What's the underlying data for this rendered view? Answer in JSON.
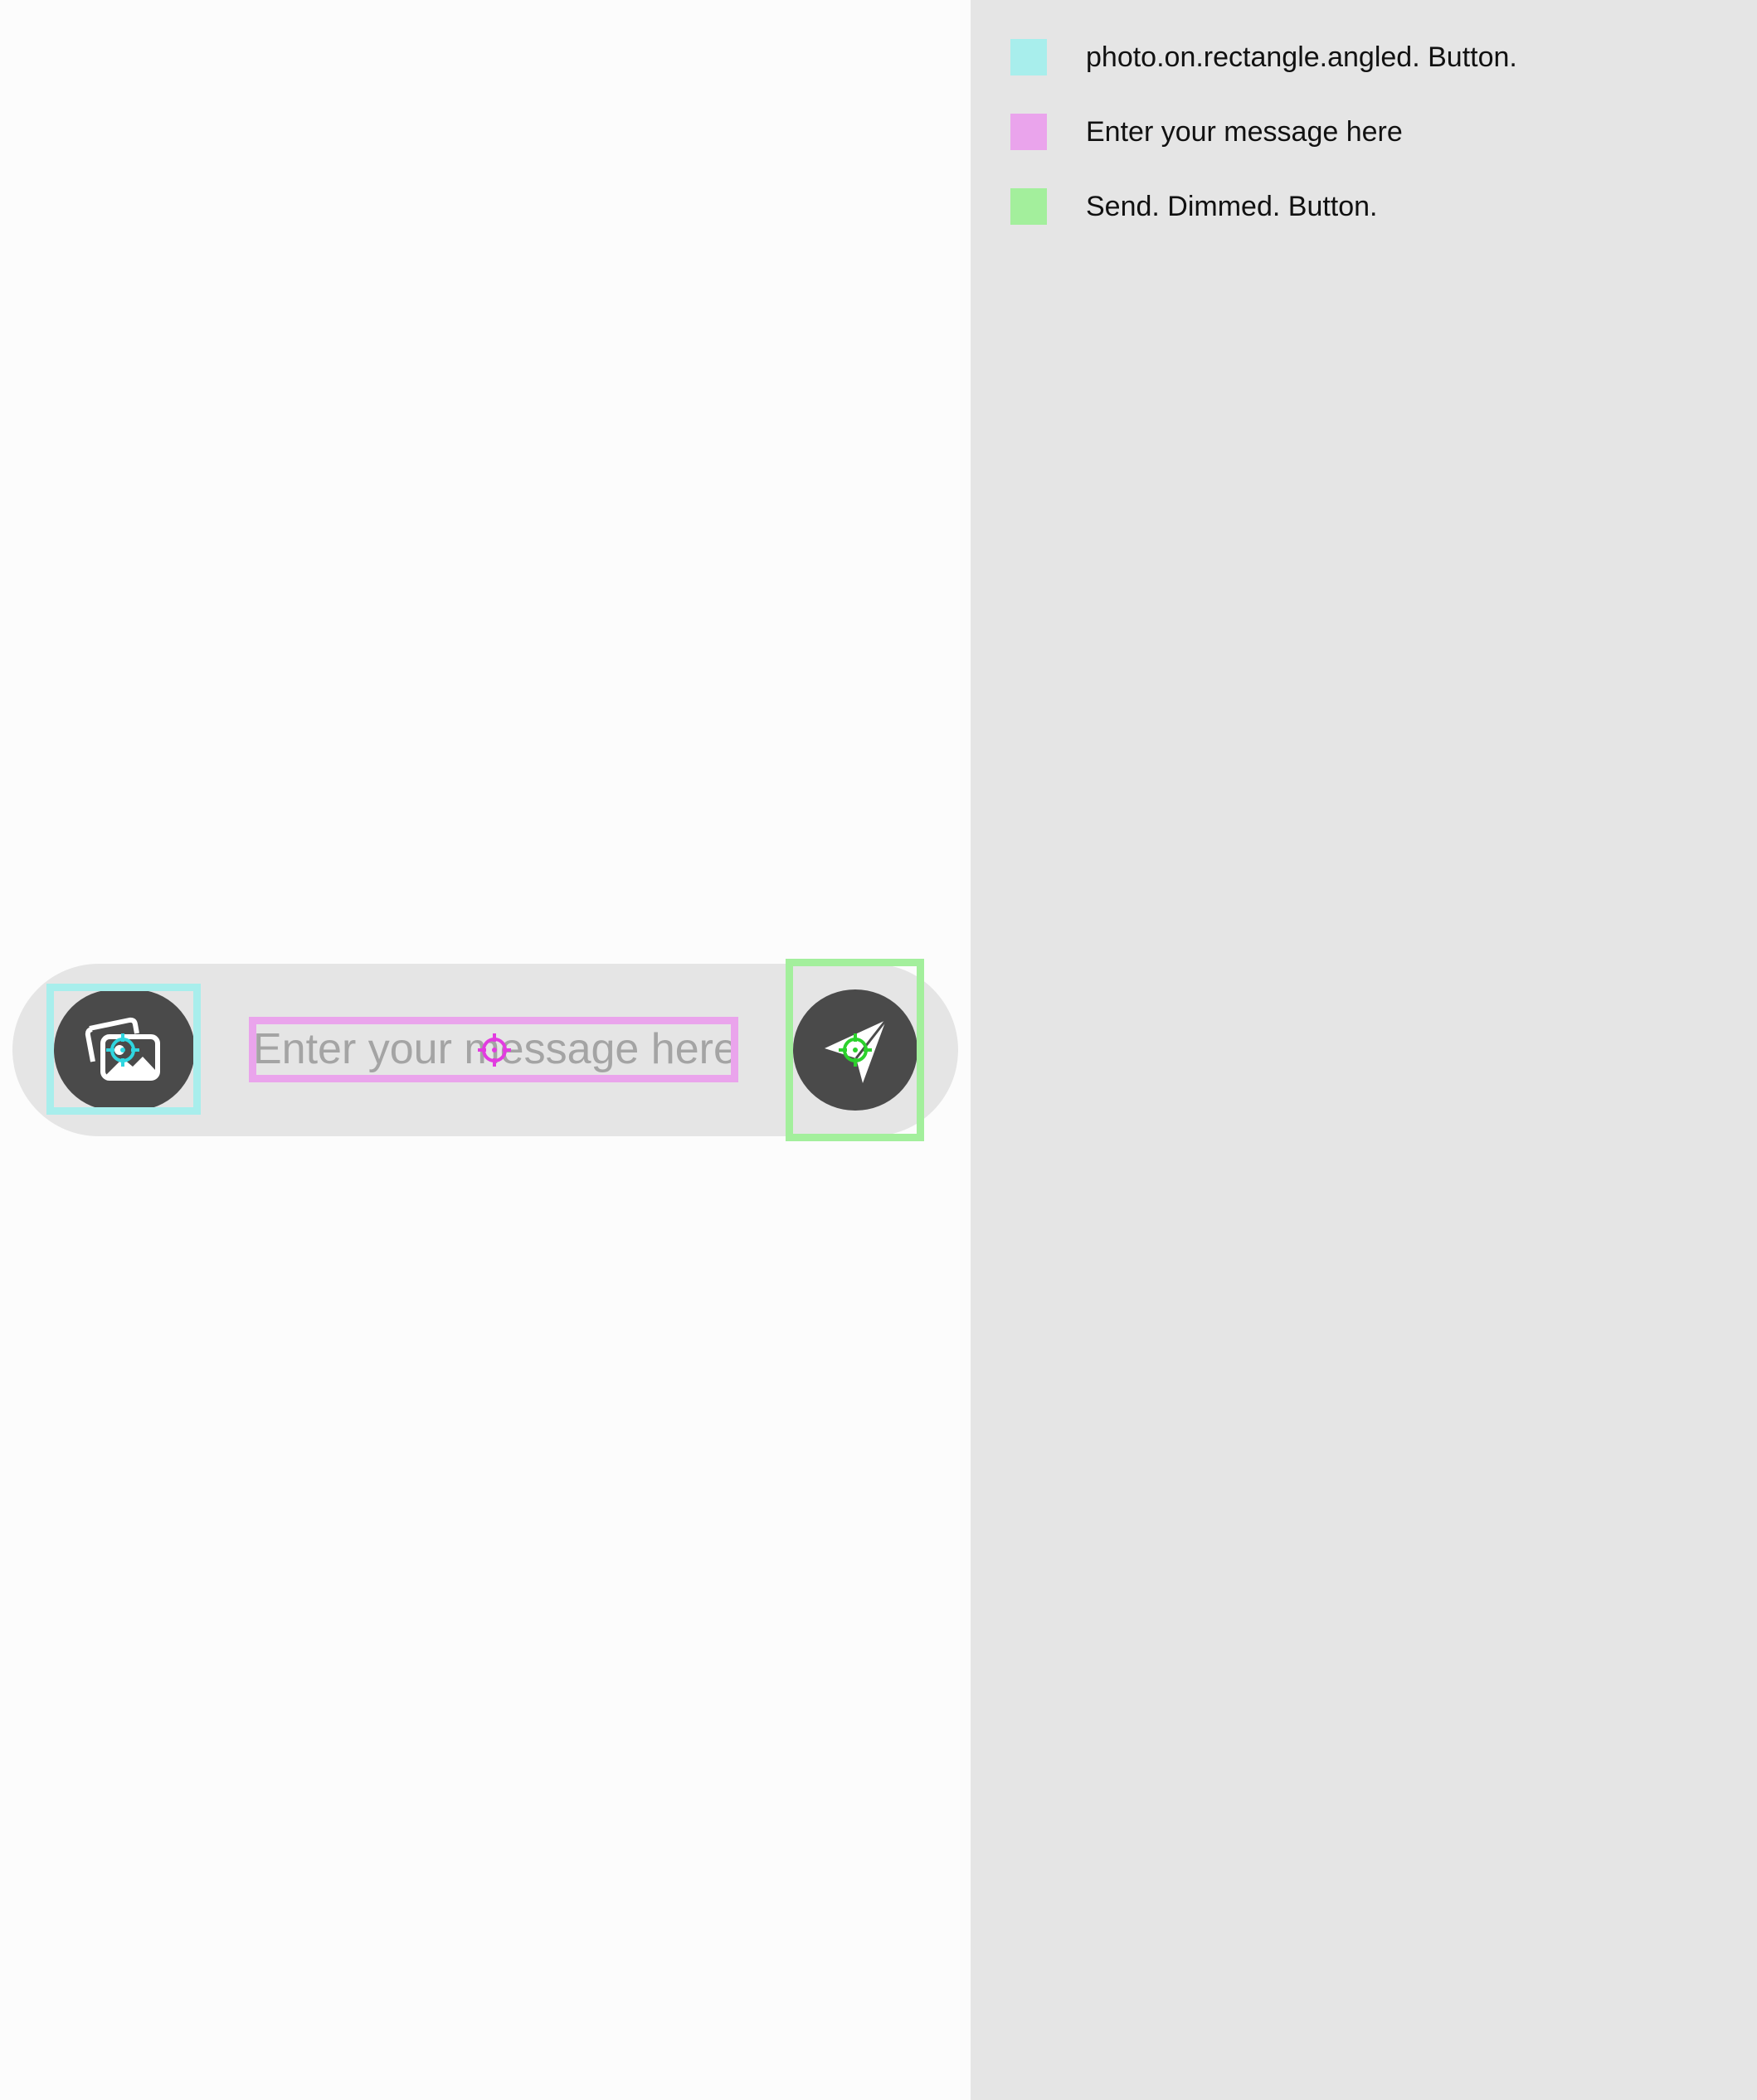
{
  "composer": {
    "photo_button_icon": "photo-on-rectangle-angled-icon",
    "message_placeholder": "Enter your message here",
    "message_value": "",
    "send_button_icon": "paper-plane-send-icon",
    "send_state": "dimmed"
  },
  "legend": {
    "items": [
      {
        "label": "photo.on.rectangle.angled. Button.",
        "color": "#a8eeec"
      },
      {
        "label": "Enter your message here",
        "color": "#eaa4ec"
      },
      {
        "label": "Send. Dimmed. Button.",
        "color": "#a3ef9c"
      }
    ]
  },
  "colors": {
    "composer_bg": "#e5e5e5",
    "button_bg": "#4a4a4a",
    "placeholder": "#a4a4a4",
    "photo_highlight": "#a8eeec",
    "text_highlight": "#eaa4ec",
    "send_highlight": "#a3ef9c"
  }
}
